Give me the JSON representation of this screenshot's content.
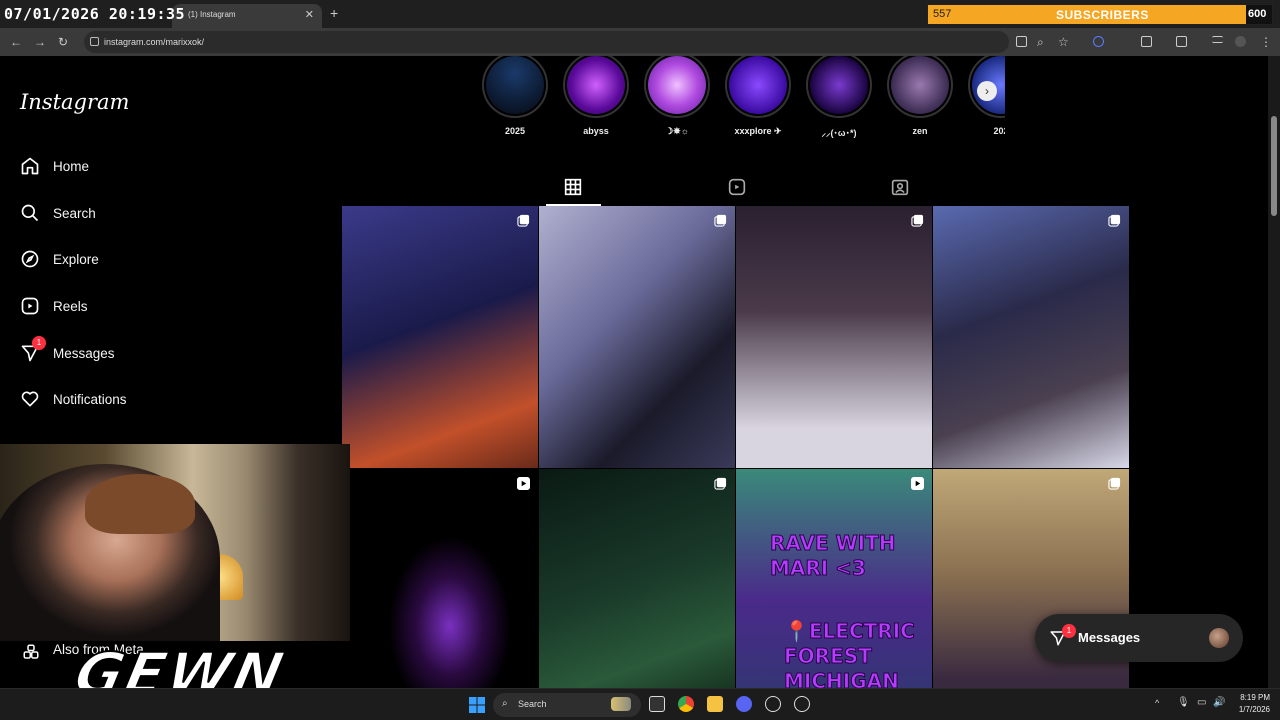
{
  "overlay": {
    "clock": "07/01/2026 20:19:35",
    "subscribers_count": "557",
    "subscribers_label": "SUBSCRIBERS",
    "subscribers_goal": "600",
    "streamer_logo": "GEWN"
  },
  "browser": {
    "tab_title": "(1) Instagram",
    "url": "instagram.com/marixxok/"
  },
  "instagram": {
    "logo": "Instagram",
    "nav": [
      {
        "label": "Home",
        "icon": "home-icon"
      },
      {
        "label": "Search",
        "icon": "search-icon"
      },
      {
        "label": "Explore",
        "icon": "compass-icon"
      },
      {
        "label": "Reels",
        "icon": "reels-icon"
      },
      {
        "label": "Messages",
        "icon": "messenger-icon",
        "badge": "1"
      },
      {
        "label": "Notifications",
        "icon": "heart-icon"
      },
      {
        "label": "Also from Meta",
        "icon": "meta-apps-icon"
      }
    ],
    "highlights": [
      {
        "label": "2025",
        "color": "#0b1a3a"
      },
      {
        "label": "abyss",
        "color": "#8a1fd0"
      },
      {
        "label": "☽✵☼",
        "color": "#b04be0"
      },
      {
        "label": "xxxplore ✈",
        "color": "#4a1ab0"
      },
      {
        "label": "⸝⸝(･ω･*)",
        "color": "#3a0a8a"
      },
      {
        "label": "zen",
        "color": "#4a2a70"
      },
      {
        "label": "202",
        "color": "#2a3aa0"
      }
    ],
    "profile_tabs": [
      "grid-icon",
      "reels-icon",
      "tagged-icon"
    ],
    "posts": [
      {
        "type": "carousel",
        "colors": [
          "#2a2a6a",
          "#c25a2a"
        ]
      },
      {
        "type": "carousel",
        "colors": [
          "#9a9ac0",
          "#2a2a3a"
        ]
      },
      {
        "type": "carousel",
        "colors": [
          "#3a3040",
          "#e8e4f0"
        ]
      },
      {
        "type": "carousel",
        "colors": [
          "#4a5aa0",
          "#2a2a3a"
        ]
      },
      {
        "type": "reel",
        "colors": [
          "#000000",
          "#a040ff"
        ]
      },
      {
        "type": "carousel",
        "colors": [
          "#0a2a1a",
          "#1a4a2a"
        ]
      },
      {
        "type": "reel",
        "colors": [
          "#2a7a6a",
          "#5a30a0"
        ],
        "text_top": "RAVE WITH MARI <3",
        "text_bottom": "📍ELECTRIC FOREST MICHIGAN"
      },
      {
        "type": "carousel",
        "colors": [
          "#b8a070",
          "#4a3a5a"
        ]
      }
    ],
    "messages_pill": {
      "label": "Messages",
      "badge": "1"
    }
  },
  "taskbar": {
    "search_placeholder": "Search",
    "time": "8:19 PM",
    "date": "1/7/2026"
  }
}
